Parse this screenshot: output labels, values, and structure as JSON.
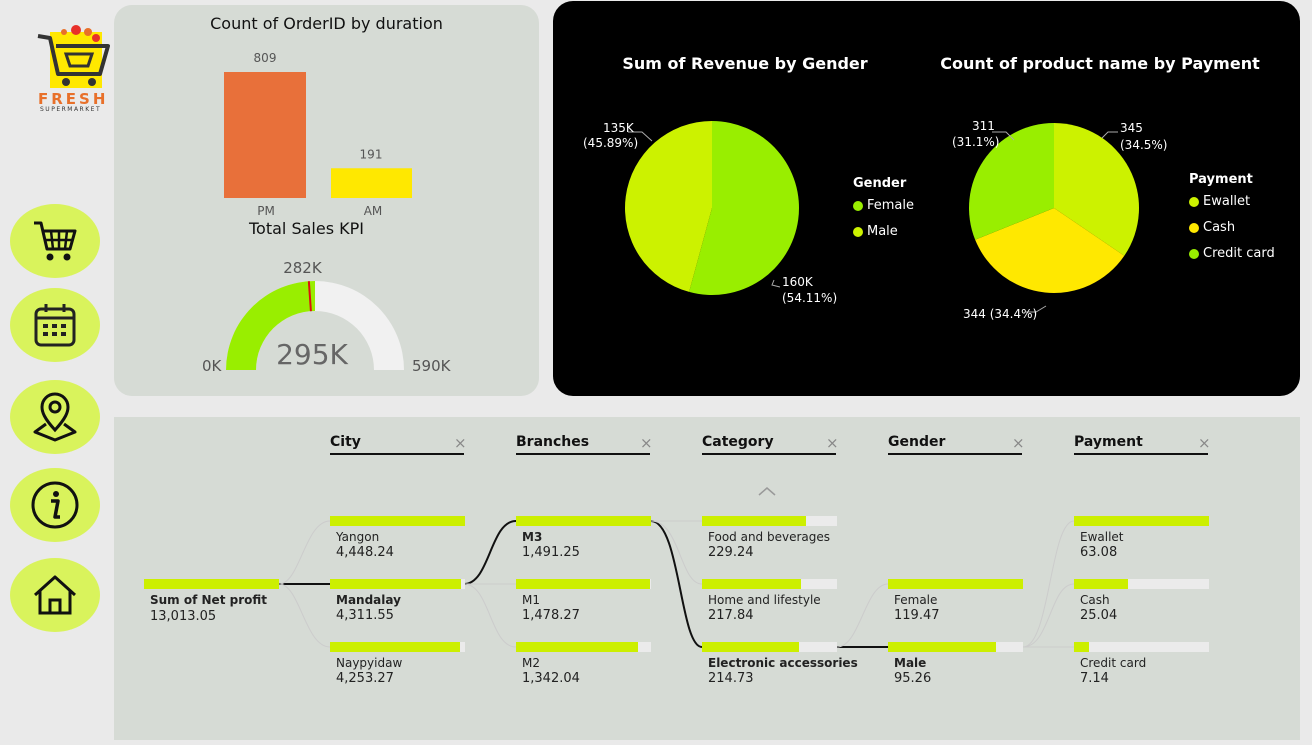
{
  "logo": {
    "name": "FRESH",
    "sub": "SUPERMARKET"
  },
  "nav": [
    "cart",
    "calendar",
    "location",
    "info",
    "home"
  ],
  "duration_chart": {
    "title": "Count of OrderID by duration",
    "chart_data": {
      "type": "bar",
      "categories": [
        "PM",
        "AM"
      ],
      "values": [
        809,
        191
      ],
      "colors": [
        "#e8703a",
        "#ffe800"
      ]
    }
  },
  "kpi": {
    "title": "Total Sales KPI",
    "value": "295K",
    "min": "0K",
    "max": "590K",
    "target": "282K",
    "value_num": 295,
    "min_num": 0,
    "max_num": 590,
    "target_num": 282
  },
  "revenue_chart": {
    "title": "Sum of Revenue by Gender",
    "legend_title": "Gender",
    "chart_data": {
      "type": "pie",
      "labels": [
        "Female",
        "Male"
      ],
      "values": [
        160,
        135
      ],
      "display": [
        "160K (54.11%)",
        "135K (45.89%)"
      ],
      "colors": [
        "#99ee00",
        "#ccf200"
      ]
    },
    "label_female_1": "160K",
    "label_female_2": "(54.11%)",
    "label_male_1": "135K",
    "label_male_2": "(45.89%)"
  },
  "payment_chart": {
    "title": "Count of product name by Payment",
    "legend_title": "Payment",
    "chart_data": {
      "type": "pie",
      "labels": [
        "Ewallet",
        "Cash",
        "Credit card"
      ],
      "values": [
        345,
        344,
        311
      ],
      "percent": [
        34.5,
        34.4,
        31.1
      ],
      "colors": [
        "#ccf200",
        "#ffe800",
        "#99ee00"
      ]
    },
    "label_ewallet_1": "345",
    "label_ewallet_2": "(34.5%)",
    "label_cash": "344 (34.4%)",
    "label_credit_1": "311",
    "label_credit_2": "(31.1%)"
  },
  "tree": {
    "headers": [
      "City",
      "Branches",
      "Category",
      "Gender",
      "Payment"
    ],
    "root": {
      "label": "Sum of Net profit",
      "value": "13,013.05"
    },
    "city": [
      {
        "label": "Yangon",
        "value": "4,448.24",
        "pct": 1.0
      },
      {
        "label": "Mandalay",
        "value": "4,311.55",
        "pct": 0.97
      },
      {
        "label": "Naypyidaw",
        "value": "4,253.27",
        "pct": 0.96
      }
    ],
    "branches": [
      {
        "label": "M3",
        "value": "1,491.25",
        "pct": 1.0
      },
      {
        "label": "M1",
        "value": "1,478.27",
        "pct": 0.99
      },
      {
        "label": "M2",
        "value": "1,342.04",
        "pct": 0.9
      }
    ],
    "category": [
      {
        "label": "Food and beverages",
        "value": "229.24",
        "pct": 0.77
      },
      {
        "label": "Home and lifestyle",
        "value": "217.84",
        "pct": 0.73
      },
      {
        "label": "Electronic accessories",
        "value": "214.73",
        "pct": 0.72
      }
    ],
    "gender": [
      {
        "label": "Female",
        "value": "119.47",
        "pct": 1.0
      },
      {
        "label": "Male",
        "value": "95.26",
        "pct": 0.8
      }
    ],
    "payment": [
      {
        "label": "Ewallet",
        "value": "63.08",
        "pct": 1.0
      },
      {
        "label": "Cash",
        "value": "25.04",
        "pct": 0.4
      },
      {
        "label": "Credit card",
        "value": "7.14",
        "pct": 0.11
      }
    ]
  }
}
